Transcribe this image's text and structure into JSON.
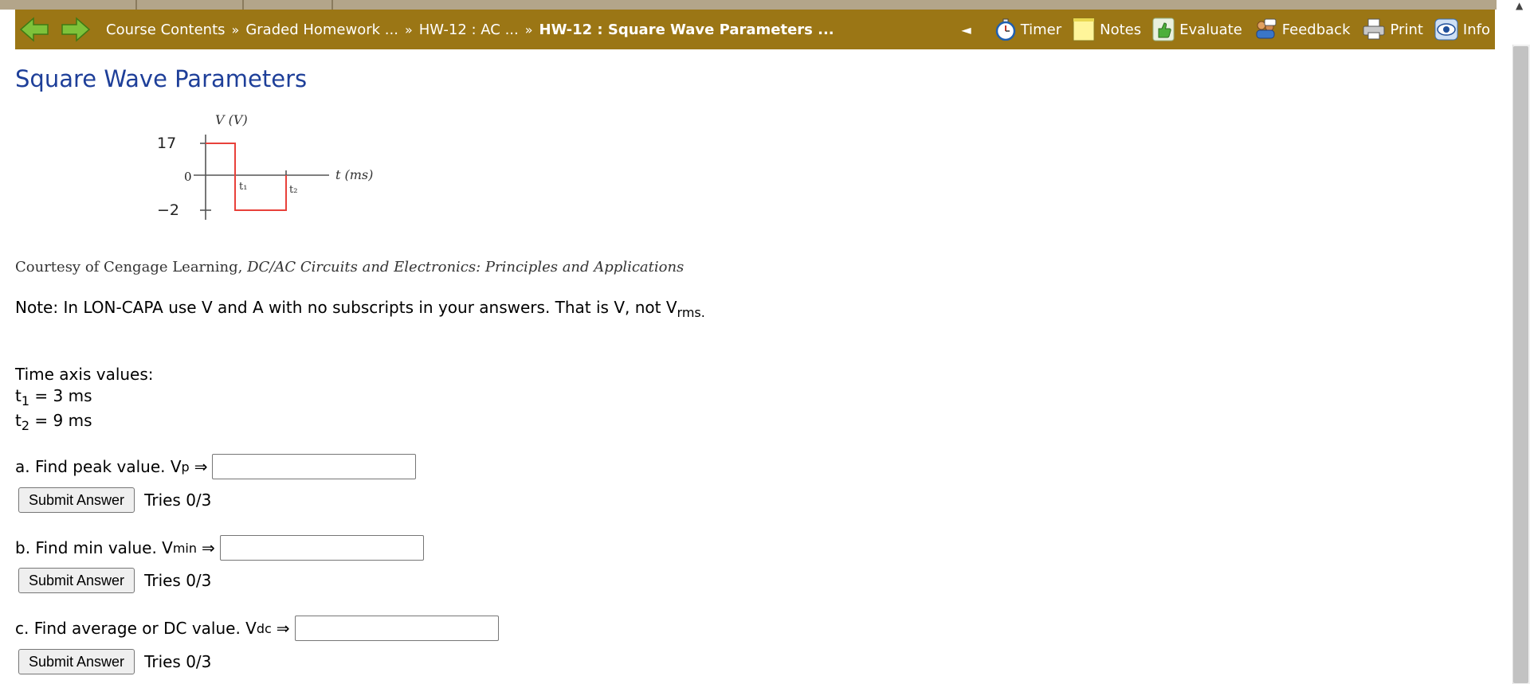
{
  "nav": {
    "back_icon": "back-arrow-icon",
    "forward_icon": "forward-arrow-icon",
    "breadcrumbs": [
      "Course Contents",
      "Graded Homework ...",
      "HW-12 : AC ...",
      "HW-12 : Square Wave Parameters ..."
    ],
    "crumb_separator": "»",
    "collapse": "◄",
    "tools": [
      {
        "label": "Timer",
        "icon": "stopwatch-icon"
      },
      {
        "label": "Notes",
        "icon": "notepad-icon"
      },
      {
        "label": "Evaluate",
        "icon": "thumbs-up-icon"
      },
      {
        "label": "Feedback",
        "icon": "feedback-icon"
      },
      {
        "label": "Print",
        "icon": "printer-icon"
      },
      {
        "label": "Info",
        "icon": "info-eye-icon"
      }
    ]
  },
  "page": {
    "title": "Square Wave Parameters",
    "figure": {
      "y_axis_label": "V (V)",
      "x_axis_label": "t (ms)",
      "y_high": "17",
      "y_zero": "0",
      "y_low": "−2",
      "t1_label": "t₁",
      "t2_label": "t₂",
      "wave_color": "#e8413a"
    },
    "credit_prefix": "Courtesy of Cengage Learning, ",
    "credit_title": "DC/AC Circuits and Electronics: Principles and Applications",
    "note_text": "Note: In LON-CAPA use V and A with no subscripts in your answers. That is V, not V",
    "note_sub": "rms.",
    "time_heading": "Time axis values:",
    "t1_name": "t",
    "t1_sub": "1",
    "t1_value": " = 3 ms",
    "t2_name": "t",
    "t2_sub": "2",
    "t2_value": " = 9 ms"
  },
  "questions": [
    {
      "prefix": "a. Find peak value. V",
      "sub": "p",
      "arrow": "⇒",
      "value": "",
      "submit": "Submit Answer",
      "tries": "Tries 0/3"
    },
    {
      "prefix": "b. Find min value. V",
      "sub": "min",
      "arrow": "⇒",
      "value": "",
      "submit": "Submit Answer",
      "tries": "Tries 0/3"
    },
    {
      "prefix": "c. Find average or DC value. V",
      "sub": "dc",
      "arrow": "⇒",
      "value": "",
      "submit": "Submit Answer",
      "tries": "Tries 0/3"
    }
  ],
  "colors": {
    "nav_bg": "#9b7615",
    "title": "#1e3f99"
  }
}
